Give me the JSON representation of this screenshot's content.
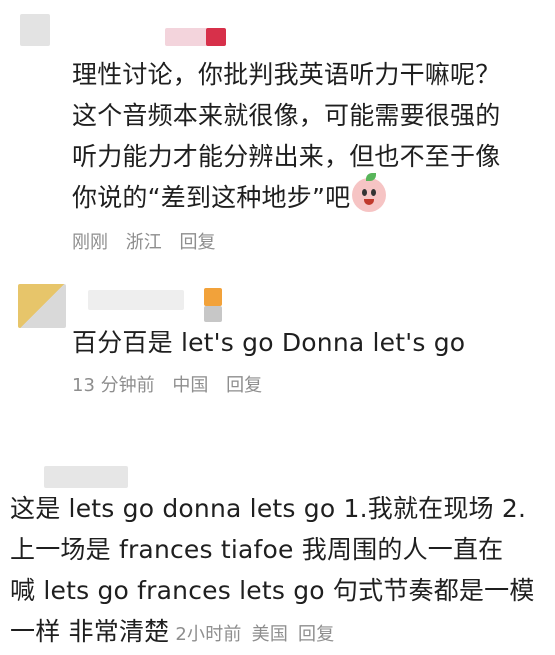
{
  "comments": [
    {
      "lines": [
        "理性讨论，你批判我英语听力干嘛呢？",
        "这个音频本来就很像，可能需要很强的",
        "听力能力才能分辨出来，但也不至于像",
        "你说的“差到这种地步”吧"
      ],
      "emoji": "peach-face-emoji",
      "time": "刚刚",
      "location": "浙江",
      "reply": "回复"
    },
    {
      "text": "百分百是 let's go Donna let's go",
      "time": "13 分钟前",
      "location": "中国",
      "reply": "回复"
    },
    {
      "lines": [
        "这是 lets go donna lets go 1.我就在现场 2.",
        "上一场是 frances tiafoe 我周围的人一直在",
        "喊 lets go frances lets go 句式节奏都是一模",
        "一样 非常清楚"
      ],
      "time": "2小时前",
      "location": "美国",
      "reply": "回复"
    }
  ],
  "colors": {
    "text": "#1f1f1f",
    "meta": "#8e8e8e",
    "background": "#ffffff"
  }
}
